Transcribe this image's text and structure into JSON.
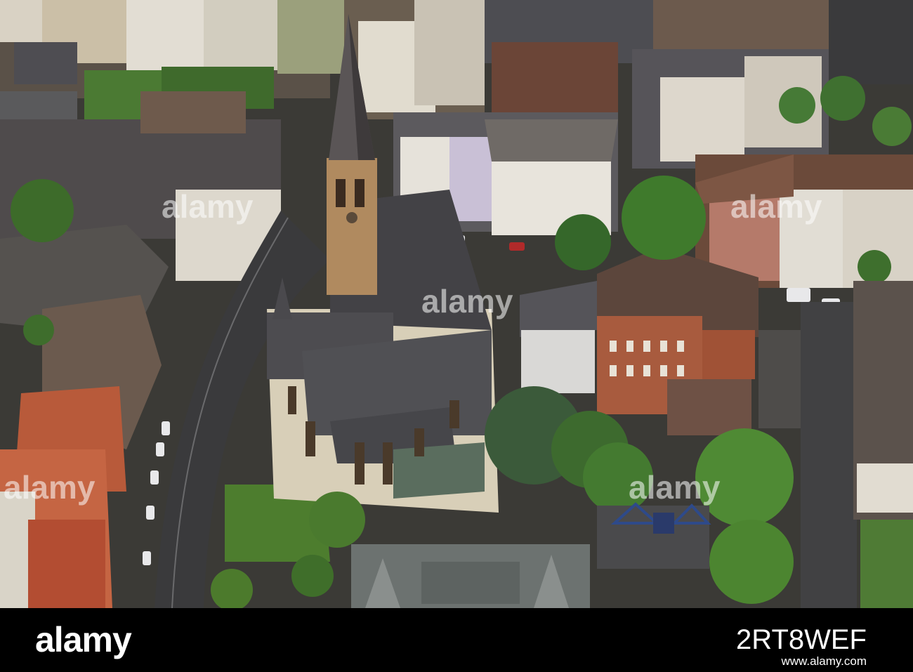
{
  "watermark": {
    "text": "alamy"
  },
  "footer": {
    "logo": "alamy",
    "image_id": "2RT8WEF",
    "url": "www.alamy.com"
  },
  "colors": {
    "roof_dark": "#4a4a4d",
    "roof_brown": "#6b4a3a",
    "facade_light": "#e8e4dc",
    "church_wall": "#d8cfb8",
    "tree_green": "#3d6b2a",
    "street": "#3a3a3c",
    "footer_bg": "#000000"
  },
  "scene": {
    "subject": "church-with-tall-spire",
    "surroundings": "dense-residential-blocks"
  }
}
